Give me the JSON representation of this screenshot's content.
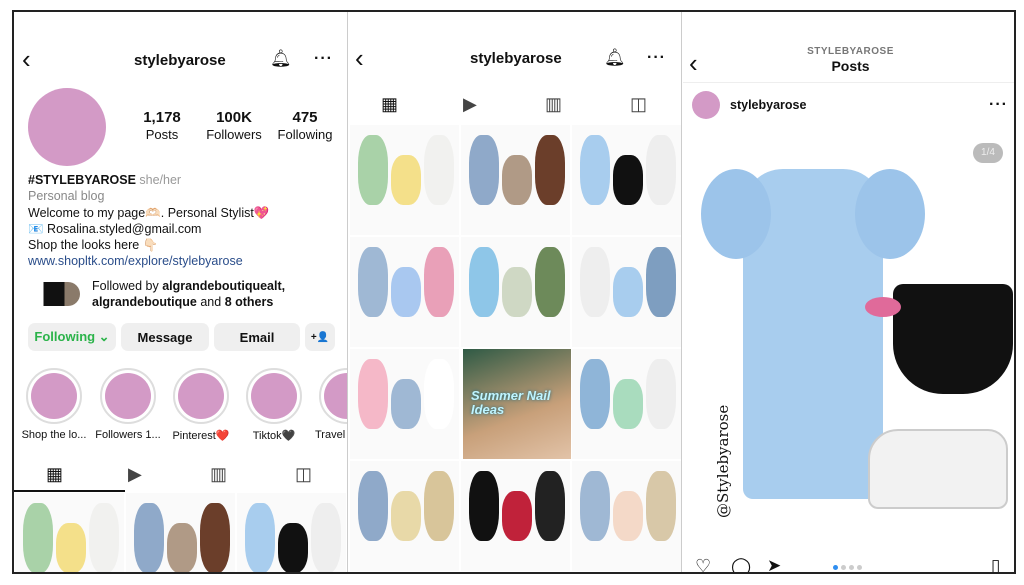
{
  "profile": {
    "username": "stylebyarose",
    "stats": [
      {
        "value": "1,178",
        "label": "Posts"
      },
      {
        "value": "100K",
        "label": "Followers"
      },
      {
        "value": "475",
        "label": "Following"
      }
    ],
    "name": "#STYLEBYAROSE",
    "pronouns": "she/her",
    "category": "Personal blog",
    "bio": [
      "Welcome to my page🫶🏻. Personal Stylist💖",
      "📧 Rosalina.styled@gmail.com",
      "Shop the looks here 👇🏻"
    ],
    "link": "www.shopltk.com/explore/stylebyarose",
    "followed_by_prefix": "Followed by ",
    "followed_by_1": "algrandeboutiquealt,",
    "followed_by_2": "algrandeboutique",
    "followed_by_mid": " and ",
    "followed_by_3": "8 others",
    "buttons": {
      "following": "Following ⌄",
      "message": "Message",
      "email": "Email",
      "add_user": "+👤"
    },
    "highlights": [
      "Shop the lo...",
      "Followers 1...",
      "Pinterest❤️",
      "Tiktok🖤",
      "Travel"
    ],
    "avatar_color": "#d39ac6",
    "following_color": "#2bb34a"
  },
  "grid_view": {
    "username": "stylebyarose",
    "overlay_text": "Summer Nail Ideas"
  },
  "post_view": {
    "subtitle": "STYLEBYAROSE",
    "title": "Posts",
    "username": "stylebyarose",
    "counter": "1/4",
    "watermark": "@Stylebyarose"
  },
  "icons": [
    "back-icon",
    "bell-icon",
    "more-icon",
    "grid-icon",
    "reels-icon",
    "guide-icon",
    "tagged-icon",
    "heart-icon",
    "comment-icon",
    "share-icon",
    "bookmark-icon"
  ]
}
